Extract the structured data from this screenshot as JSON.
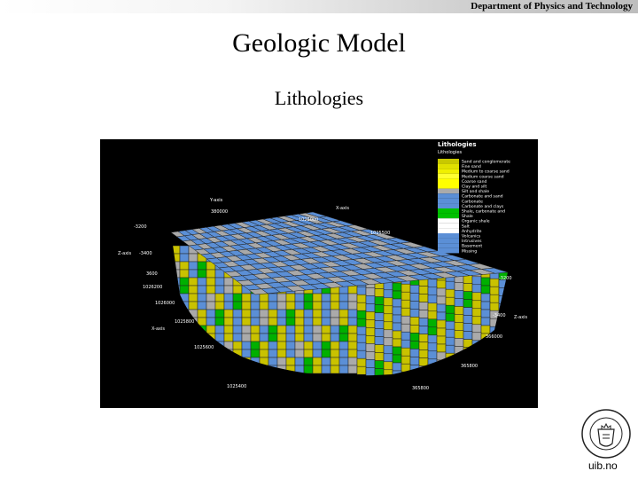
{
  "header": {
    "department": "Department of Physics and Technology"
  },
  "slide": {
    "title": "Geologic Model",
    "subtitle": "Lithologies"
  },
  "figure": {
    "legend_title": "Lithologies",
    "legend_subtitle": "Lithologies",
    "legend_items": [
      {
        "label": "Sand and conglomerate",
        "color": "#c8c800"
      },
      {
        "label": "Fine sand",
        "color": "#e0e000"
      },
      {
        "label": "Medium to coarse sand",
        "color": "#f0f000"
      },
      {
        "label": "Medium coarse sand",
        "color": "#ffff30"
      },
      {
        "label": "Coarse sand",
        "color": "#ffff00"
      },
      {
        "label": "Clay and silt",
        "color": "#ffff00"
      },
      {
        "label": "Silt and shale",
        "color": "#aaaaaa"
      },
      {
        "label": "Carbonate and sand",
        "color": "#5b8fd6"
      },
      {
        "label": "Carbonate",
        "color": "#5b8fd6"
      },
      {
        "label": "Carbonate and clays",
        "color": "#5b8fd6"
      },
      {
        "label": "Shale, carbonate and",
        "color": "#00c000"
      },
      {
        "label": "Shale",
        "color": "#00c000"
      },
      {
        "label": "Organic shale",
        "color": "#ffffff"
      },
      {
        "label": "Salt",
        "color": "#ffffff"
      },
      {
        "label": "Anhydrite",
        "color": "#ffffff"
      },
      {
        "label": "Volcanics",
        "color": "#5b8fd6"
      },
      {
        "label": "Intrusives",
        "color": "#5b8fd6"
      },
      {
        "label": "Basement",
        "color": "#5b8fd6"
      },
      {
        "label": "Missing",
        "color": "#5b8fd6"
      }
    ],
    "axis_labels": {
      "y_axis": "Y-axis",
      "x_axis": "X-axis",
      "x_axis_left": "X-axis",
      "z_axis": "Z-axis",
      "z_axis_left": "Z-axis",
      "z_axis_right": "Z-axis"
    },
    "ticks": {
      "y_top": "380000",
      "x_top_1": "1025000",
      "x_top_2": "1025500",
      "z_left_1": "-3200",
      "z_left_2": "-3400",
      "z_left_3": "3600",
      "x_left_1": "1026200",
      "x_left_2": "1026000",
      "x_left_3": "1025800",
      "x_left_4": "1025600",
      "x_left_5": "1025400",
      "z_right_1": "-3200",
      "z_right_2": "-3400",
      "y_right_1": "366000",
      "y_right_2": "365800",
      "y_right_3": "365800"
    }
  },
  "footer": {
    "site": "uib.no"
  }
}
